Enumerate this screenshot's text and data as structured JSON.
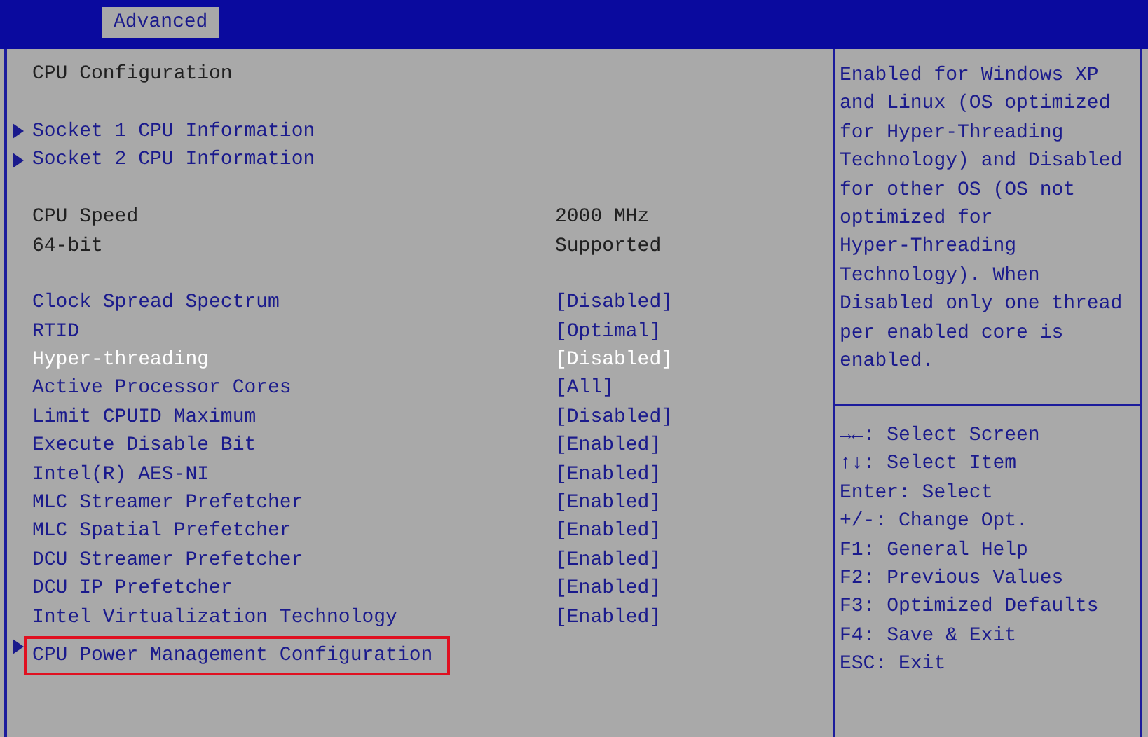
{
  "tabs": [
    {
      "label": "Advanced",
      "selected": true
    }
  ],
  "title": "CPU Configuration",
  "sections": [
    [
      {
        "kind": "submenu",
        "label": "Socket 1 CPU Information",
        "selected": false,
        "annotated": false
      },
      {
        "kind": "submenu",
        "label": "Socket 2 CPU Information",
        "selected": false,
        "annotated": false
      }
    ],
    [
      {
        "kind": "info",
        "label": "CPU Speed",
        "value": "2000 MHz",
        "selected": false,
        "annotated": false
      },
      {
        "kind": "info",
        "label": "64-bit",
        "value": "Supported",
        "selected": false,
        "annotated": false
      }
    ],
    [
      {
        "kind": "option",
        "label": "Clock Spread Spectrum",
        "value": "[Disabled]",
        "selected": false,
        "annotated": false
      },
      {
        "kind": "option",
        "label": "RTID",
        "value": "[Optimal]",
        "selected": false,
        "annotated": false
      },
      {
        "kind": "option",
        "label": "Hyper-threading",
        "value": "[Disabled]",
        "selected": true,
        "annotated": false
      },
      {
        "kind": "option",
        "label": "Active Processor Cores",
        "value": "[All]",
        "selected": false,
        "annotated": false
      },
      {
        "kind": "option",
        "label": "Limit CPUID Maximum",
        "value": "[Disabled]",
        "selected": false,
        "annotated": false
      },
      {
        "kind": "option",
        "label": "Execute Disable Bit",
        "value": "[Enabled]",
        "selected": false,
        "annotated": false
      },
      {
        "kind": "option",
        "label": "Intel(R) AES-NI",
        "value": "[Enabled]",
        "selected": false,
        "annotated": false
      },
      {
        "kind": "option",
        "label": "MLC Streamer Prefetcher",
        "value": "[Enabled]",
        "selected": false,
        "annotated": false
      },
      {
        "kind": "option",
        "label": "MLC Spatial Prefetcher",
        "value": "[Enabled]",
        "selected": false,
        "annotated": false
      },
      {
        "kind": "option",
        "label": "DCU Streamer Prefetcher",
        "value": "[Enabled]",
        "selected": false,
        "annotated": false
      },
      {
        "kind": "option",
        "label": "DCU IP Prefetcher",
        "value": "[Enabled]",
        "selected": false,
        "annotated": false
      },
      {
        "kind": "option",
        "label": "Intel Virtualization Technology",
        "value": "[Enabled]",
        "selected": false,
        "annotated": false
      },
      {
        "kind": "submenu",
        "label": "CPU Power Management Configuration",
        "selected": false,
        "annotated": true
      }
    ]
  ],
  "help_lines": [
    "Enabled for Windows XP",
    "and Linux (OS optimized",
    "for Hyper-Threading",
    "Technology) and Disabled",
    "for other OS (OS not",
    "optimized for",
    "Hyper-Threading",
    "Technology). When",
    "Disabled only one thread",
    "per enabled core is",
    "enabled."
  ],
  "keys": [
    "→←: Select Screen",
    "↑↓: Select Item",
    "Enter: Select",
    "+/-: Change Opt.",
    "F1: General Help",
    "F2: Previous Values",
    "F3: Optimized Defaults",
    "F4: Save & Exit",
    "ESC: Exit"
  ]
}
